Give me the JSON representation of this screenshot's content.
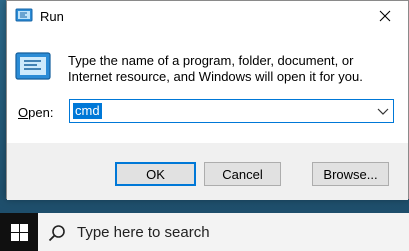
{
  "window": {
    "title": "Run"
  },
  "dialog": {
    "description": "Type the name of a program, folder, document, or Internet resource, and Windows will open it for you.",
    "open_label_underlined": "O",
    "open_label_rest": "pen:",
    "open_value": "cmd"
  },
  "buttons": {
    "ok": "OK",
    "cancel": "Cancel",
    "browse": "Browse..."
  },
  "taskbar": {
    "search_placeholder": "Type here to search"
  },
  "icons": {
    "app": "run-icon",
    "close": "close-icon",
    "dropdown": "chevron-down-icon",
    "start": "windows-logo-icon",
    "search": "search-icon"
  },
  "colors": {
    "accent": "#0078d7",
    "footer": "#f0f0f0",
    "taskbar": "#101010"
  }
}
